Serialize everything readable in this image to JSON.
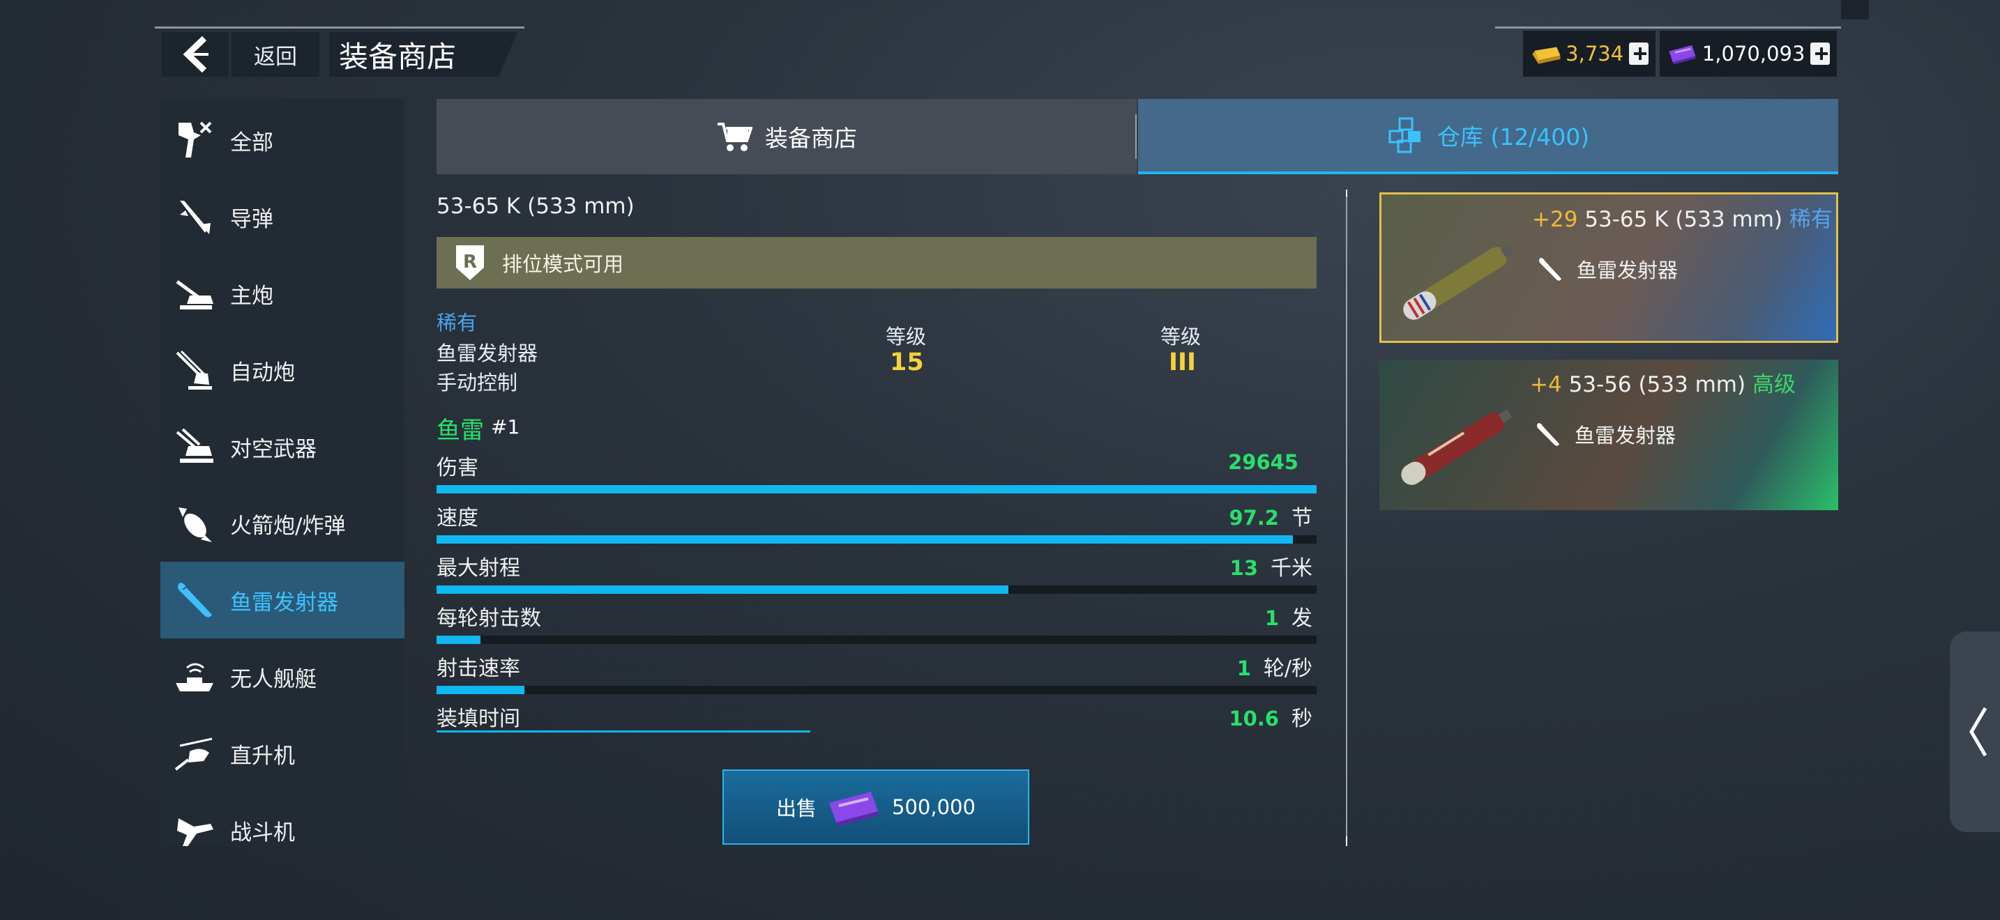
{
  "header": {
    "back_label": "返回",
    "title": "装备商店",
    "gold": "3,734",
    "premium": "1,070,093"
  },
  "sidebar": {
    "items": [
      {
        "label": "全部",
        "icon": "all-icon"
      },
      {
        "label": "导弹",
        "icon": "missile-icon"
      },
      {
        "label": "主炮",
        "icon": "main-gun-icon"
      },
      {
        "label": "自动炮",
        "icon": "autocannon-icon"
      },
      {
        "label": "对空武器",
        "icon": "anti-air-icon"
      },
      {
        "label": "火箭炮/炸弹",
        "icon": "rocket-bomb-icon"
      },
      {
        "label": "鱼雷发射器",
        "icon": "torpedo-icon",
        "active": true
      },
      {
        "label": "无人舰艇",
        "icon": "drone-boat-icon"
      },
      {
        "label": "直升机",
        "icon": "helicopter-icon"
      },
      {
        "label": "战斗机",
        "icon": "fighter-icon"
      }
    ]
  },
  "tabs": {
    "shop": "装备商店",
    "warehouse": "仓库 (12/400)"
  },
  "detail": {
    "name": "53-65 K (533 mm)",
    "ranked_banner": "排位模式可用",
    "rarity": "稀有",
    "type": "鱼雷发射器",
    "control": "手动控制",
    "level_label_1": "等级",
    "level_value_1": "15",
    "level_label_2": "等级",
    "level_value_2": "III",
    "ammo_name": "鱼雷",
    "ammo_index": "#1",
    "stats": [
      {
        "label": "伤害",
        "value": "29645",
        "unit": "",
        "fill": 1.0
      },
      {
        "label": "速度",
        "value": "97.2",
        "unit": "节",
        "fill": 0.973
      },
      {
        "label": "最大射程",
        "value": "13",
        "unit": "千米",
        "fill": 0.65
      },
      {
        "label": "每轮射击数",
        "value": "1",
        "unit": "发",
        "fill": 0.05
      },
      {
        "label": "射击速率",
        "value": "1",
        "unit": "轮/秒",
        "fill": 0.1
      },
      {
        "label": "装填时间",
        "value": "10.6",
        "unit": "秒",
        "fill": 0.425
      }
    ],
    "sell_label": "出售",
    "sell_price": "500,000"
  },
  "inventory": [
    {
      "level": "+29",
      "name": "53-65 K (533 mm)",
      "rarity": "稀有",
      "rarity_color": "#5aa2f0",
      "type": "鱼雷发射器",
      "selected": true
    },
    {
      "level": "+4",
      "name": "53-56 (533 mm)",
      "rarity": "高级",
      "rarity_color": "#3fd56a",
      "type": "鱼雷发射器",
      "selected": false
    }
  ],
  "colors": {
    "accent": "#10b7f1",
    "stat_value": "#27e06a",
    "level_value": "#f2d33a",
    "selected_border": "#e3c14b"
  }
}
